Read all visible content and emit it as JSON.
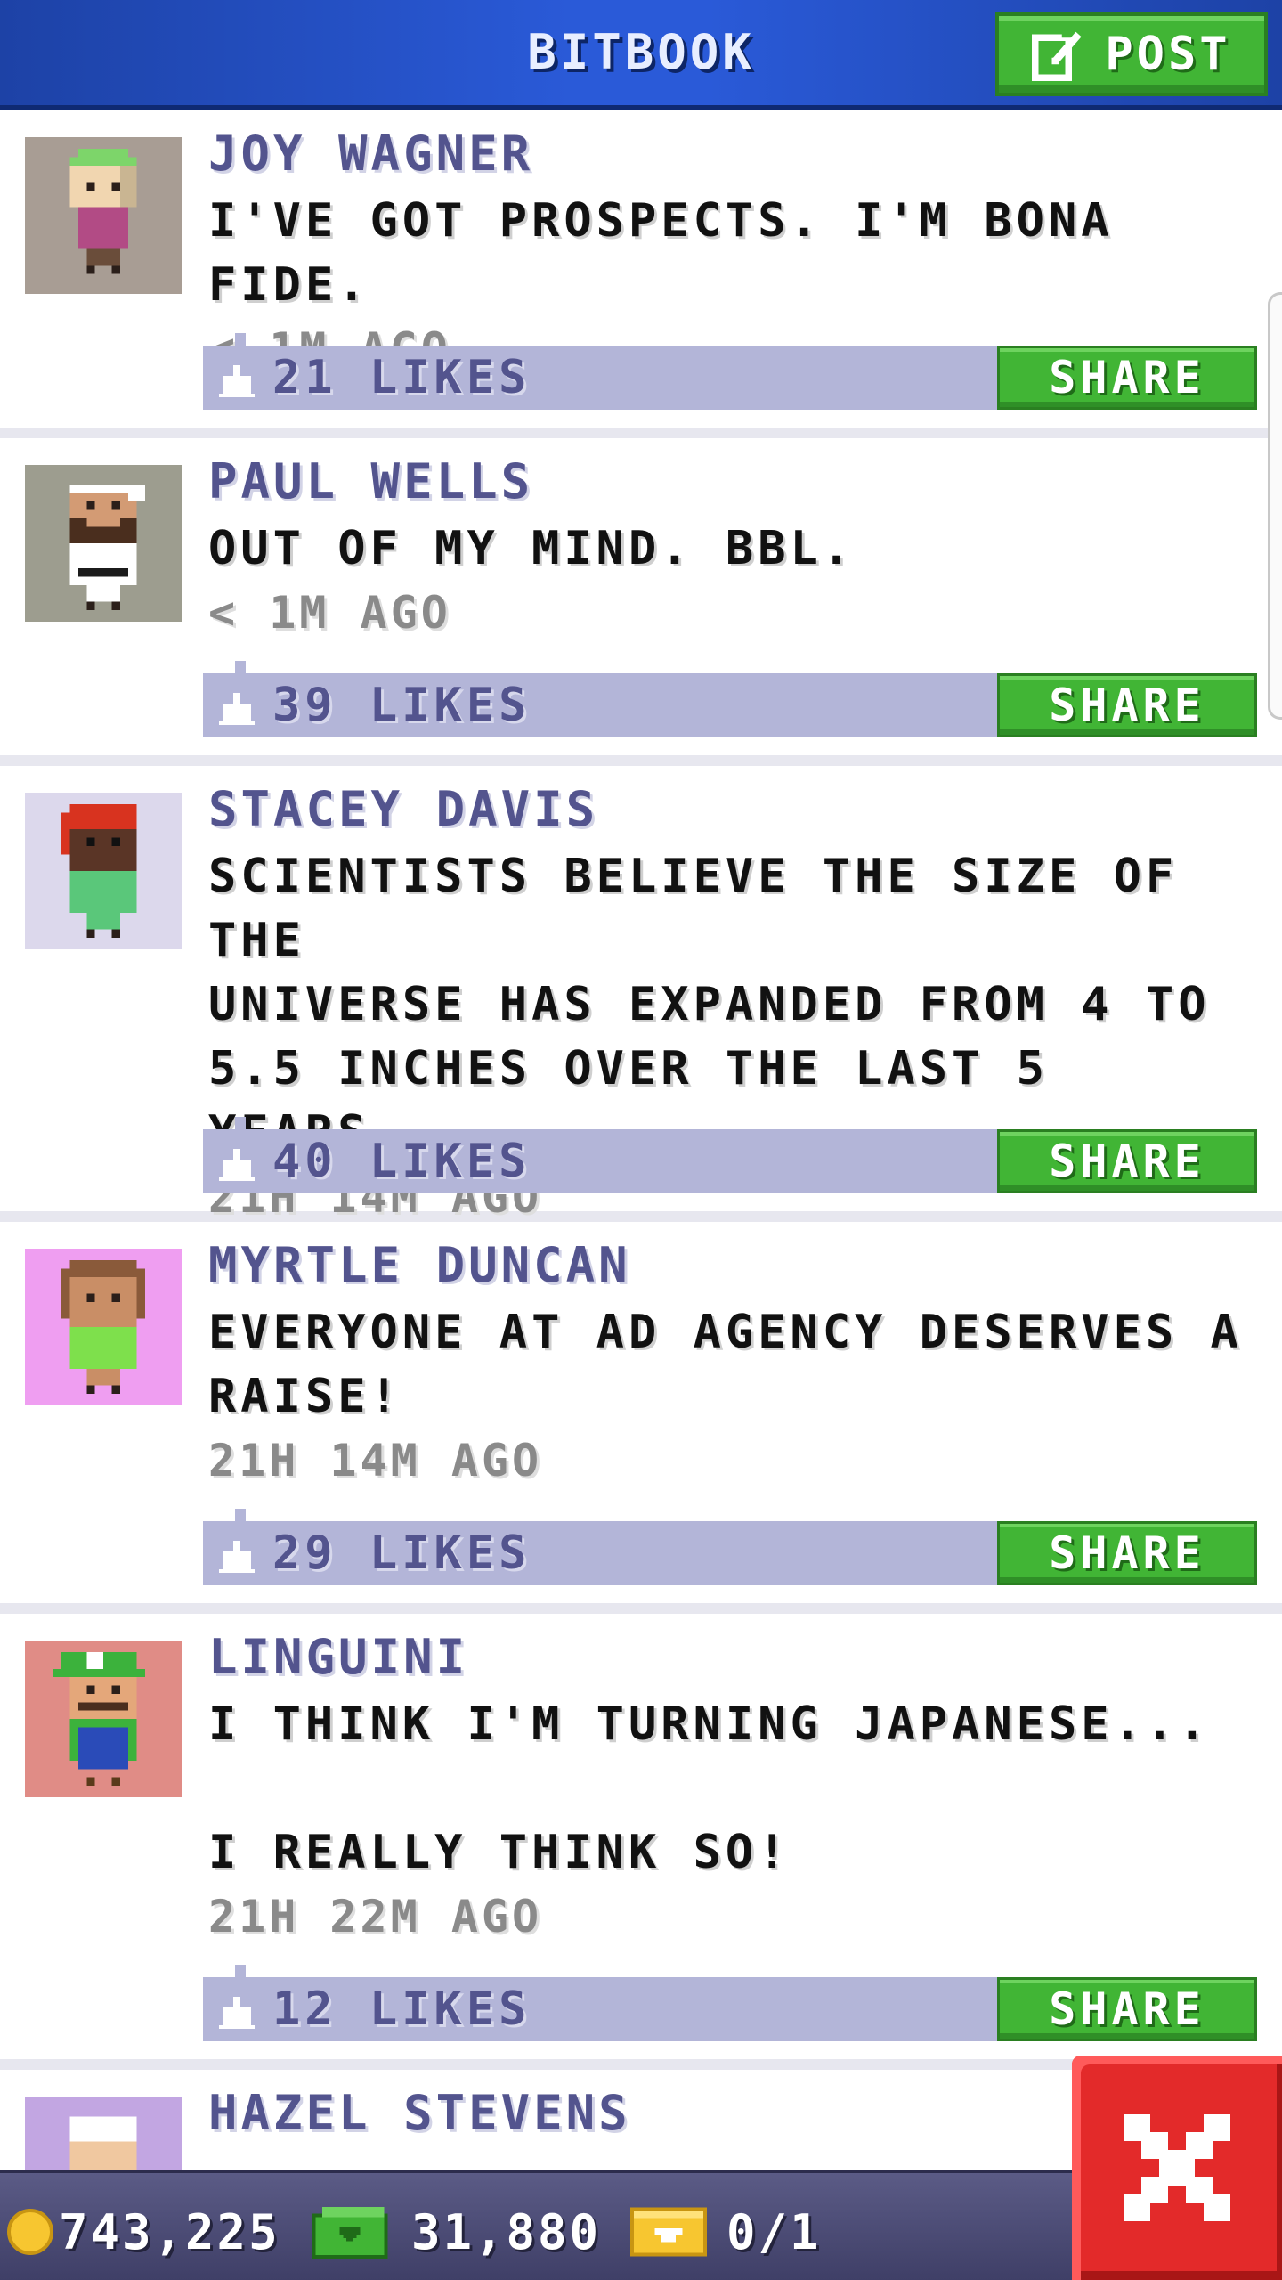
{
  "header": {
    "title": "BITBOOK",
    "post_label": "POST"
  },
  "posts": [
    {
      "author": "JOY WAGNER",
      "message": "I'VE GOT PROSPECTS. I'M BONA FIDE.",
      "time": "< 1M AGO",
      "likes": "21 LIKES",
      "share_label": "SHARE",
      "avatar_bg": "#a89d94"
    },
    {
      "author": "PAUL WELLS",
      "message": "OUT OF MY MIND. BBL.",
      "time": "< 1M AGO",
      "likes": "39 LIKES",
      "share_label": "SHARE",
      "avatar_bg": "#9d9d8f"
    },
    {
      "author": "STACEY DAVIS",
      "message": "SCIENTISTS BELIEVE THE SIZE OF THE\nUNIVERSE HAS EXPANDED FROM 4 TO\n5.5 INCHES OVER THE LAST 5 YEARS.",
      "time": "21H 14M AGO",
      "likes": "40 LIKES",
      "share_label": "SHARE",
      "avatar_bg": "#dcd8ec"
    },
    {
      "author": "MYRTLE DUNCAN",
      "message": "EVERYONE AT AD AGENCY DESERVES A\nRAISE!",
      "time": "21H 14M AGO",
      "likes": "29 LIKES",
      "share_label": "SHARE",
      "avatar_bg": "#ef9ef1"
    },
    {
      "author": "LINGUINI",
      "message": "I THINK I'M TURNING JAPANESE...\n\nI REALLY THINK SO!",
      "time": "21H 22M AGO",
      "likes": "12 LIKES",
      "share_label": "SHARE",
      "avatar_bg": "#e08c86"
    },
    {
      "author": "HAZEL STEVENS",
      "avatar_bg": "#c2a6e2"
    }
  ],
  "bottom_bar": {
    "coins": "743,225",
    "bux": "31,880",
    "vip": "0/1"
  },
  "colors": {
    "header_blue": "#2a5ad8",
    "accent_green": "#41b535",
    "likes_bar": "#b3b5d8",
    "close_red": "#e32a2a"
  },
  "icons": {
    "post": "compose-icon",
    "like": "thumbs-up-icon",
    "close": "close-icon",
    "coin": "coin-icon",
    "bux": "bux-icon",
    "vip": "vip-ticket-icon"
  }
}
